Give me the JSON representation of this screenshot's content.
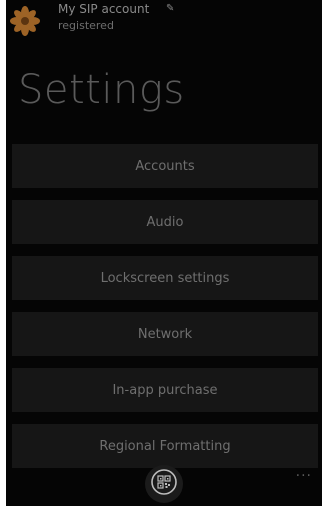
{
  "account": {
    "name": "My SIP account",
    "status": "registered",
    "avatar_icon": "flower-avatar-icon",
    "edit_icon": "pencil-icon"
  },
  "page": {
    "title": "Settings"
  },
  "menu": {
    "items": [
      {
        "label": "Accounts"
      },
      {
        "label": "Audio"
      },
      {
        "label": "Lockscreen settings"
      },
      {
        "label": "Network"
      },
      {
        "label": "In-app purchase"
      },
      {
        "label": "Regional Formatting"
      }
    ]
  },
  "app_bar": {
    "main_button_icon": "qr-code-icon",
    "more_label": "..."
  },
  "colors": {
    "background": "#050505",
    "tile": "#161616",
    "text": "#6f6f6f",
    "avatar_accent": "#c07a2a"
  }
}
